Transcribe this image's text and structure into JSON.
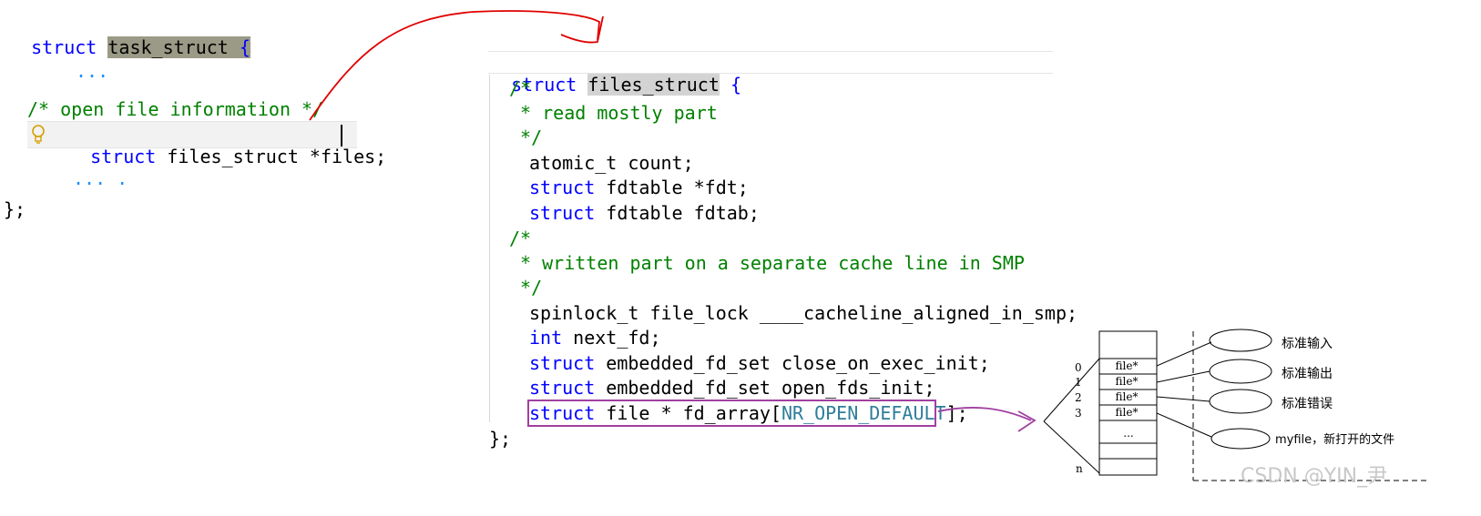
{
  "left_code": {
    "kw_struct": "struct",
    "task_struct_name": "task_struct",
    "open_brace": "{",
    "ellipsis1": "...",
    "comment": "/* open file information */",
    "files_kw": "struct",
    "files_decl": "files_struct *files;",
    "ellipsis2": "... .",
    "close": "};"
  },
  "right_code": {
    "kw_struct": "struct",
    "files_struct_name": "files_struct",
    "open_brace": "{",
    "c1": "/*",
    "c2": " * read mostly part",
    "c3": " */",
    "atomic": "atomic_t count;",
    "fdt_kw": "struct",
    "fdt_rest": "fdtable *fdt;",
    "fdtab_kw": "struct",
    "fdtab_rest": "fdtable fdtab;",
    "c4": "/*",
    "c5": " * written part on a separate cache line in SMP",
    "c6": " */",
    "spinlock": "spinlock_t file_lock ____cacheline_aligned_in_smp;",
    "int_kw": "int",
    "int_rest": "next_fd;",
    "close_kw": "struct",
    "close_rest": "embedded_fd_set close_on_exec_init;",
    "open_kw": "struct",
    "open_rest": "embedded_fd_set open_fds_init;",
    "arr_kw": "struct",
    "arr_rest": "file * fd_array[",
    "arr_const": "NR_OPEN_DEFAULT",
    "arr_end": "];",
    "close": "};"
  },
  "fd_table": {
    "indices": [
      "0",
      "1",
      "2",
      "3",
      "n"
    ],
    "cells": [
      "file*",
      "file*",
      "file*",
      "file*",
      "..."
    ],
    "targets": [
      "标准输入",
      "标准输出",
      "标准错误",
      "myfile，新打开的文件"
    ]
  },
  "watermark": "CSDN @YIN_尹",
  "colors": {
    "keyword": "#0000ff",
    "comment": "#008000",
    "highlight_box": "#9a9a86",
    "red_arrow": "#e00000",
    "purple": "#a040a0"
  }
}
